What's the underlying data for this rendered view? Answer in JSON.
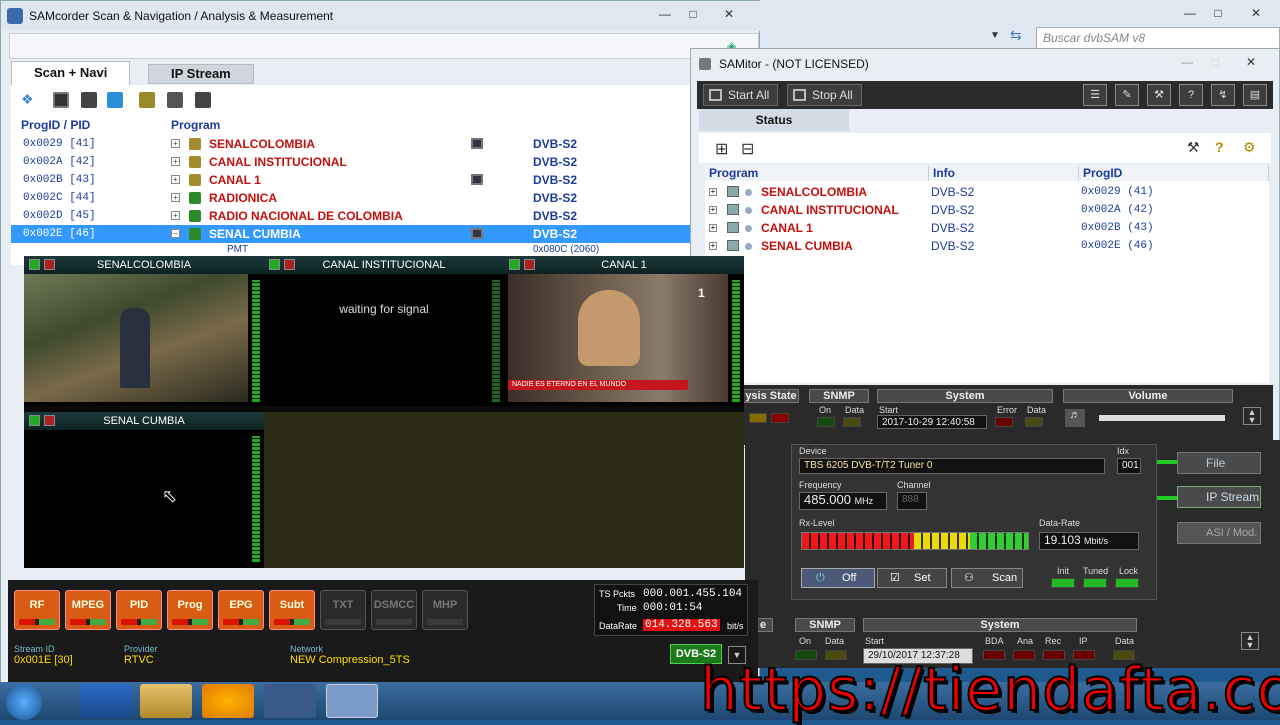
{
  "samcorder": {
    "title": "SAMcorder Scan & Navigation / Analysis & Measurement",
    "tabs": [
      "Scan + Navi",
      "IP Stream"
    ],
    "columns": {
      "progid": "ProgID / PID",
      "program": "Program"
    },
    "rows": [
      {
        "pid": "0x0029 [41]",
        "name": "SENALCOLOMBIA",
        "std": "DVB-S2",
        "tv": true,
        "selected": false
      },
      {
        "pid": "0x002A [42]",
        "name": "CANAL INSTITUCIONAL",
        "std": "DVB-S2",
        "tv": false,
        "selected": false
      },
      {
        "pid": "0x002B [43]",
        "name": "CANAL 1",
        "std": "DVB-S2",
        "tv": true,
        "selected": false
      },
      {
        "pid": "0x002C [44]",
        "name": "RADIONICA",
        "std": "DVB-S2",
        "tv": false,
        "selected": false
      },
      {
        "pid": "0x002D [45]",
        "name": "RADIO NACIONAL DE COLOMBIA",
        "std": "DVB-S2",
        "tv": false,
        "selected": false
      },
      {
        "pid": "0x002E [46]",
        "name": "SENAL CUMBIA",
        "std": "DVB-S2",
        "tv": true,
        "selected": true
      }
    ],
    "pmt": {
      "label": "PMT",
      "value": "0x080C (2060)"
    },
    "analysis_buttons": [
      {
        "label": "RF",
        "on": true
      },
      {
        "label": "MPEG",
        "on": true
      },
      {
        "label": "PID",
        "on": true
      },
      {
        "label": "Prog",
        "on": true
      },
      {
        "label": "EPG",
        "on": true
      },
      {
        "label": "Subt",
        "on": true
      },
      {
        "label": "TXT",
        "on": false
      },
      {
        "label": "DSMCC",
        "on": false
      },
      {
        "label": "MHP",
        "on": false
      }
    ],
    "ts_packets_label": "TS Pckts",
    "ts_packets": "000.001.455.104",
    "time_label": "Time",
    "time": "000:01:54",
    "datarate_label": "DataRate",
    "datarate": "014.328.563",
    "datarate_unit": "bit/s",
    "stream_id_label": "Stream ID",
    "stream_id": "0x001E [30]",
    "provider_label": "Provider",
    "provider": "RTVC",
    "network_label": "Network",
    "network": "NEW Compression_5TS",
    "standard_badge": "DVB-S2"
  },
  "browser": {
    "search_placeholder": "Buscar dvbSAM v8"
  },
  "samitor": {
    "title": "SAMitor - (NOT LICENSED)",
    "start_all": "Start All",
    "stop_all": "Stop All",
    "status_tab": "Status",
    "columns": {
      "program": "Program",
      "info": "Info",
      "progid": "ProgID"
    },
    "rows": [
      {
        "name": "SENALCOLOMBIA",
        "info": "DVB-S2",
        "progid": "0x0029 (41)"
      },
      {
        "name": "CANAL INSTITUCIONAL",
        "info": "DVB-S2",
        "progid": "0x002A (42)"
      },
      {
        "name": "CANAL 1",
        "info": "DVB-S2",
        "progid": "0x002B (43)"
      },
      {
        "name": "SENAL CUMBIA",
        "info": "DVB-S2",
        "progid": "0x002E (46)"
      }
    ],
    "status_bar": {
      "analysis_state": "ysis State",
      "snmp": "SNMP",
      "on": "On",
      "data": "Data",
      "system": "System",
      "start": "Start",
      "start_value": "2017-10-29 12:40:58",
      "error": "Error",
      "volume": "Volume"
    }
  },
  "tuner": {
    "device_label": "Device",
    "device": "TBS 6205 DVB-T/T2 Tuner 0",
    "idx_label": "Idx",
    "idx": "001",
    "frequency_label": "Frequency",
    "frequency": "485.000",
    "freq_unit": "MHz",
    "channel_label": "Channel",
    "channel": "888",
    "rxlevel_label": "Rx-Level",
    "datarate_label": "Data-Rate",
    "datarate": "19.103",
    "datarate_unit": "Mbit/s",
    "off": "Off",
    "set": "Set",
    "scan": "Scan",
    "init": "Init",
    "tuned": "Tuned",
    "lock": "Lock",
    "side_buttons": [
      "File",
      "IP Stream",
      "ASI / Mod."
    ]
  },
  "lower_status": {
    "snmp": "SNMP",
    "on": "On",
    "data": "Data",
    "system": "System",
    "start": "Start",
    "start_value": "29/10/2017 12:37:28",
    "bda": "BDA",
    "ana": "Ana",
    "rec": "Rec",
    "ip": "IP",
    "data2": "Data",
    "e_label": "e"
  },
  "videowall": {
    "tiles": [
      {
        "title": "SENALCOLOMBIA",
        "message": ""
      },
      {
        "title": "CANAL INSTITUCIONAL",
        "message": "waiting for signal"
      },
      {
        "title": "CANAL 1",
        "message": "",
        "ticker": "NADIE ES ETERNO EN EL MUNDO"
      },
      {
        "title": "SENAL CUMBIA",
        "message": ""
      }
    ]
  },
  "watermark": "https://tiendafta.co"
}
